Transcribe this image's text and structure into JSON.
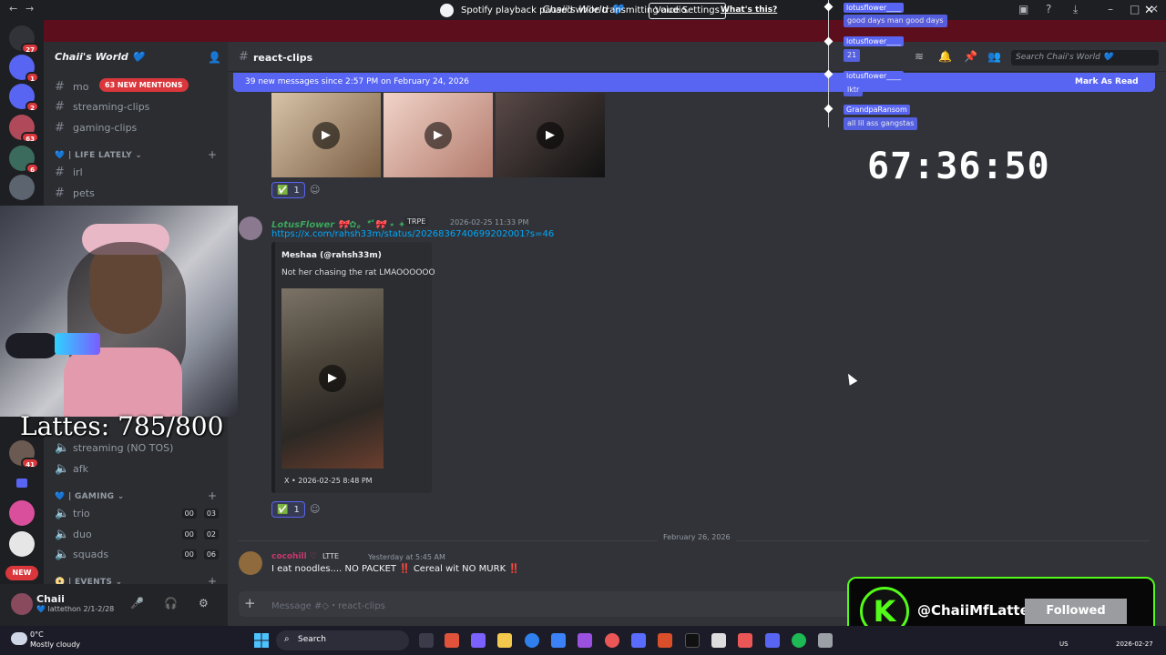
{
  "window": {
    "title": "Chaii's World 💙",
    "nav_back": "←",
    "nav_forward": "→"
  },
  "banner": {
    "text": "Spotify playback paused while transmitting audio.",
    "button": "Voice Settings",
    "link": "What's this?",
    "close": "✕"
  },
  "rail": {
    "dm_badge": "27",
    "servers": [
      {
        "badge": "1",
        "color": "#5865f2"
      },
      {
        "badge": "2",
        "color": "#5865f2"
      },
      {
        "badge": "63",
        "color": "#b04a5a"
      },
      {
        "badge": "6",
        "color": "#3a6b5c"
      },
      {
        "badge": "",
        "color": "#5c6470"
      }
    ],
    "lower_badge": "41",
    "new_badge": "NEW"
  },
  "sidebar": {
    "server_name": "Chaii's World 💙",
    "mentions_pill": "63 NEW MENTIONS",
    "channels_top": [
      {
        "name": "mo"
      },
      {
        "name": "streaming-clips"
      },
      {
        "name": "gaming-clips"
      }
    ],
    "cat_life": "💙 | LIFE LATELY ⌄",
    "channels_life": [
      {
        "name": "irl"
      },
      {
        "name": "pets"
      }
    ],
    "voice_partial": [
      {
        "name": "streaming (NO TOS)"
      },
      {
        "name": "afk"
      }
    ],
    "cat_gaming": "💙 | GAMING ⌄",
    "voice_gaming": [
      {
        "name": "trio",
        "a": "00",
        "b": "03"
      },
      {
        "name": "duo",
        "a": "00",
        "b": "02"
      },
      {
        "name": "squads",
        "a": "00",
        "b": "06"
      }
    ],
    "cat_events": "📀 | EVENTS ⌄"
  },
  "user": {
    "name": "Chaii",
    "status": "💙 lattethon 2/1-2/28"
  },
  "overlay": {
    "lattes": "Lattes: 785/800",
    "timer": "67:36:50"
  },
  "header": {
    "channel": "react-clips",
    "search_placeholder": "Search Chaii's World 💙"
  },
  "newbar": {
    "text": "39 new messages since 2:57 PM on February 24, 2026",
    "mark_read": "Mark As Read"
  },
  "messages": {
    "reaction_count": "1",
    "msg1": {
      "author": "LotusFlower 🎀✿。*ﾟ🎀 ⋆ ✦",
      "tag": "TRPE",
      "time": "2026-02-25 11:33 PM",
      "link": "https://x.com/rahsh33m/status/2026836740699202001?s=46",
      "embed_author": "Meshaa (@rahsh33m)",
      "embed_desc": "Not her chasing the rat LMAOOOOOO",
      "embed_footer": "X • 2026-02-25 8:48 PM"
    },
    "date_divider": "February 26, 2026",
    "msg2": {
      "author": "cocohill ♡",
      "tag": "LTTE",
      "time": "Yesterday at 5:45 AM",
      "text": "I eat noodles.... NO PACKET ‼️ Cereal wit NO MURK ‼️"
    },
    "composer_placeholder": "Message #◇・react-clips"
  },
  "chat_overlay": [
    {
      "name": "lotusflower____",
      "text": "good days man good days"
    },
    {
      "name": "lotusflower____",
      "text": "21"
    },
    {
      "name": "lotusflower____",
      "text": "lktr"
    },
    {
      "name": "GrandpaRansom",
      "text": "all lil ass gangstas"
    }
  ],
  "alert": {
    "logo": "K",
    "user": "@ChaiiMfLatte",
    "button": "Followed"
  },
  "taskbar": {
    "temp": "0°C",
    "weather": "Mostly cloudy",
    "search": "Search",
    "lang": "US",
    "date": "2026-02-27"
  }
}
